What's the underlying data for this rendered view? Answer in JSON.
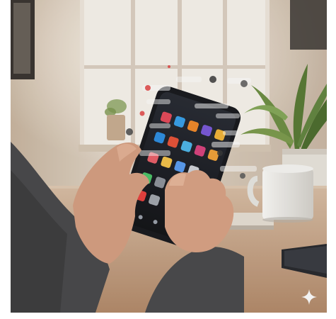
{
  "scene": {
    "caption": "",
    "colors": {
      "wall": "#d9cbb9",
      "window_light": "#f4efe6",
      "table": "#c9a88a",
      "sleeve": "#4a4a4c",
      "skin": "#d8a184",
      "phone": "#1d1e22",
      "mug": "#ecebe7",
      "plant": "#5e7f3f"
    },
    "icons": [
      "music-note-icon",
      "sparkle-icon"
    ]
  }
}
